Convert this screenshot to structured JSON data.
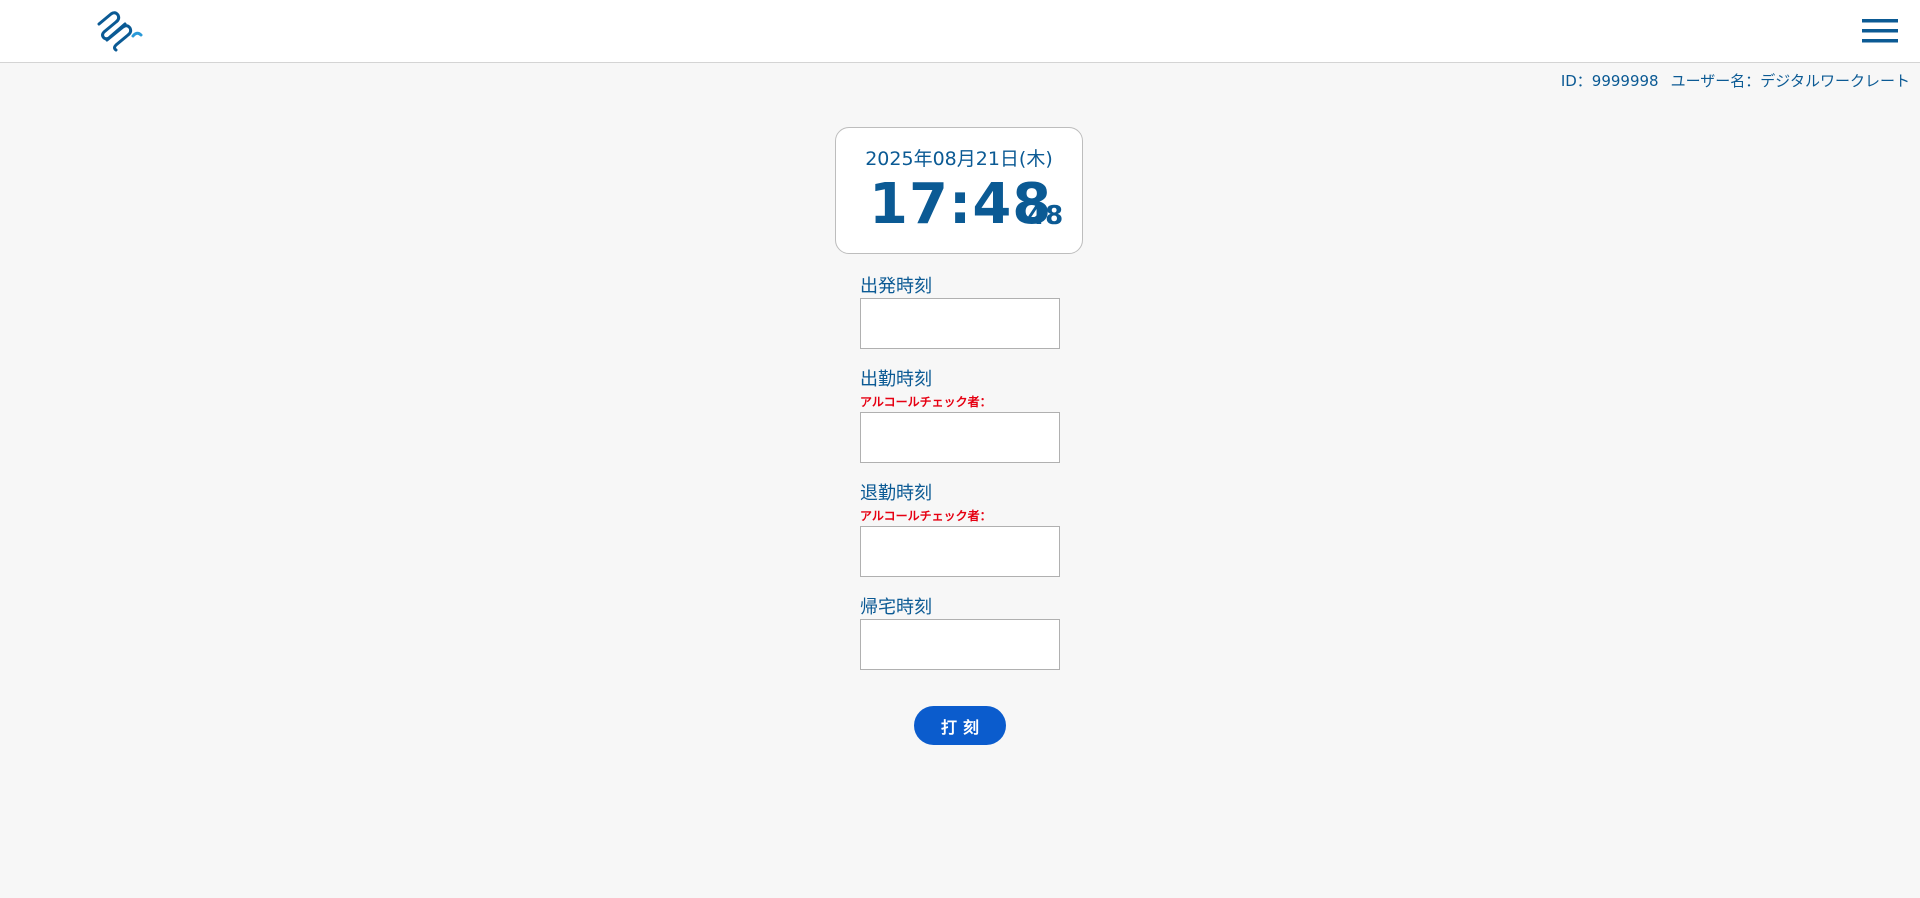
{
  "header": {
    "logo_icon": "paperclip-logo-icon",
    "menu_icon": "hamburger-menu-icon"
  },
  "user": {
    "id_text": "ID：9999998",
    "name_text": "ユーザー名：デジタルワークレート"
  },
  "clock": {
    "date": "2025年08月21日(木)",
    "time": "17:48",
    "seconds": "48"
  },
  "fields": [
    {
      "label": "出発時刻",
      "note": "",
      "value": ""
    },
    {
      "label": "出勤時刻",
      "note": "アルコールチェック者：",
      "value": ""
    },
    {
      "label": "退勤時刻",
      "note": "アルコールチェック者：",
      "value": ""
    },
    {
      "label": "帰宅時刻",
      "note": "",
      "value": ""
    }
  ],
  "punch_button_label": "打刻",
  "colors": {
    "accent": "#0b5a94",
    "button": "#0b5ccd",
    "warning": "#e60012",
    "background": "#f7f7f7"
  }
}
